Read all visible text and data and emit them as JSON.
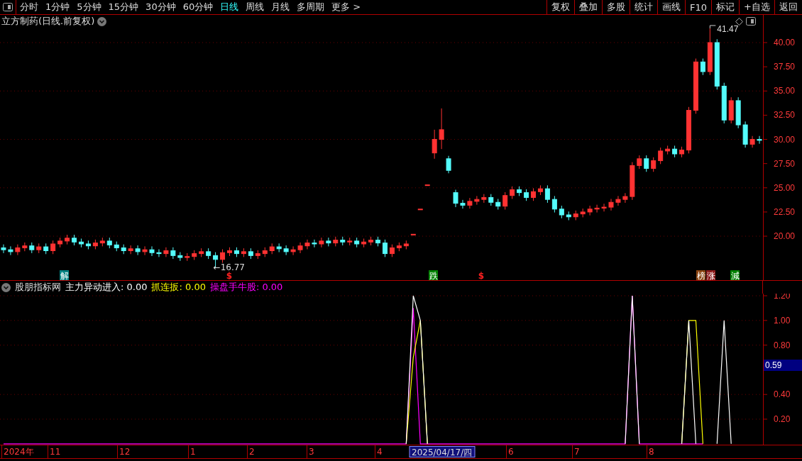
{
  "toolbar": {
    "periods": [
      {
        "label": "分时",
        "selected": false
      },
      {
        "label": "1分钟",
        "selected": false
      },
      {
        "label": "5分钟",
        "selected": false
      },
      {
        "label": "15分钟",
        "selected": false
      },
      {
        "label": "30分钟",
        "selected": false
      },
      {
        "label": "60分钟",
        "selected": false
      },
      {
        "label": "日线",
        "selected": true
      },
      {
        "label": "周线",
        "selected": false
      },
      {
        "label": "月线",
        "selected": false
      },
      {
        "label": "多周期",
        "selected": false
      },
      {
        "label": "更多 >",
        "selected": false
      }
    ],
    "actions": [
      "复权",
      "叠加",
      "多股",
      "统计",
      "画线",
      "F10",
      "标记",
      "+自选",
      "返回"
    ]
  },
  "price_panel": {
    "title": "立方制药(日线.前复权)",
    "chart_data": {
      "type": "candlestick",
      "grid": true,
      "ylim": [
        15.46,
        42.86
      ],
      "yticks": [
        {
          "value": 20,
          "label": "20.00"
        },
        {
          "value": 22.5,
          "label": "22.50"
        },
        {
          "value": 25,
          "label": "25.00"
        },
        {
          "value": 27.5,
          "label": "27.50"
        },
        {
          "value": 30,
          "label": "30.00"
        },
        {
          "value": 32.5,
          "label": "32.50"
        },
        {
          "value": 35,
          "label": "35.00"
        },
        {
          "value": 37.5,
          "label": "37.50"
        },
        {
          "value": 40,
          "label": "40.00"
        }
      ],
      "categories": [
        null,
        null,
        null,
        null,
        null,
        null,
        null,
        null,
        null,
        null,
        null,
        null,
        null,
        null,
        null,
        null,
        null,
        null,
        null,
        null,
        null,
        null,
        null,
        null,
        null,
        null,
        null,
        null,
        null,
        null,
        null,
        null,
        null,
        null,
        null,
        null,
        null,
        null,
        null,
        null,
        null,
        null,
        null,
        null,
        null,
        null,
        null,
        null,
        null,
        null,
        null,
        null,
        null,
        null,
        null,
        null,
        null,
        null,
        null,
        null,
        null,
        null,
        null,
        null,
        null,
        null,
        null,
        null,
        null,
        null,
        null,
        null,
        null,
        null,
        null,
        null,
        null,
        null,
        null,
        null,
        null,
        null,
        null,
        null,
        null,
        null,
        null,
        null,
        null,
        null,
        null,
        null,
        null,
        null,
        null,
        null,
        null,
        null,
        null,
        null,
        null,
        null,
        null,
        null,
        null,
        null,
        null,
        null
      ],
      "ohlc": [
        [
          18.8,
          19.15,
          18.25,
          18.6
        ],
        [
          18.6,
          18.95,
          18.05,
          18.4
        ],
        [
          18.4,
          19.15,
          18.05,
          18.8
        ],
        [
          18.8,
          19.35,
          18.45,
          19.0
        ],
        [
          19.0,
          19.35,
          18.25,
          18.6
        ],
        [
          18.6,
          19.25,
          18.25,
          18.9
        ],
        [
          18.9,
          19.25,
          18.15,
          18.5
        ],
        [
          18.5,
          19.55,
          18.15,
          19.2
        ],
        [
          19.2,
          19.85,
          18.85,
          19.5
        ],
        [
          19.5,
          20.15,
          19.15,
          19.8
        ],
        [
          19.8,
          20.15,
          19.05,
          19.4
        ],
        [
          19.4,
          19.75,
          18.85,
          19.2
        ],
        [
          19.2,
          19.55,
          18.65,
          19.0
        ],
        [
          19.0,
          19.65,
          18.65,
          19.3
        ],
        [
          19.3,
          19.85,
          18.95,
          19.5
        ],
        [
          19.5,
          19.85,
          18.75,
          19.1
        ],
        [
          19.1,
          19.45,
          18.45,
          18.8
        ],
        [
          18.8,
          19.15,
          18.15,
          18.5
        ],
        [
          18.5,
          19.05,
          18.15,
          18.7
        ],
        [
          18.7,
          19.05,
          18.05,
          18.4
        ],
        [
          18.4,
          18.95,
          18.05,
          18.6
        ],
        [
          18.6,
          18.95,
          17.95,
          18.3
        ],
        [
          18.3,
          18.65,
          17.85,
          18.2
        ],
        [
          18.2,
          18.85,
          17.85,
          18.5
        ],
        [
          18.5,
          18.85,
          17.65,
          18.0
        ],
        [
          18.0,
          18.35,
          17.45,
          17.8
        ],
        [
          17.8,
          18.25,
          17.45,
          17.9
        ],
        [
          17.9,
          18.55,
          17.55,
          18.2
        ],
        [
          18.2,
          18.75,
          17.85,
          18.4
        ],
        [
          18.4,
          18.75,
          17.65,
          18.0
        ],
        [
          18.0,
          18.35,
          16.77,
          17.6
        ],
        [
          17.6,
          18.65,
          17.25,
          18.3
        ],
        [
          18.3,
          18.85,
          17.95,
          18.5
        ],
        [
          18.5,
          18.85,
          17.85,
          18.2
        ],
        [
          18.2,
          18.75,
          17.85,
          18.4
        ],
        [
          18.4,
          18.75,
          17.65,
          18.0
        ],
        [
          18.0,
          18.55,
          17.65,
          18.2
        ],
        [
          18.2,
          18.85,
          17.85,
          18.5
        ],
        [
          18.5,
          19.25,
          18.15,
          18.9
        ],
        [
          18.9,
          19.25,
          18.35,
          18.7
        ],
        [
          18.7,
          19.05,
          18.05,
          18.4
        ],
        [
          18.4,
          18.95,
          18.05,
          18.6
        ],
        [
          18.6,
          19.35,
          18.25,
          19.0
        ],
        [
          19.0,
          19.65,
          18.65,
          19.3
        ],
        [
          19.3,
          19.65,
          18.85,
          19.2
        ],
        [
          19.2,
          19.85,
          18.85,
          19.5
        ],
        [
          19.5,
          19.85,
          18.95,
          19.3
        ],
        [
          19.3,
          19.95,
          18.95,
          19.6
        ],
        [
          19.6,
          19.95,
          19.05,
          19.4
        ],
        [
          19.4,
          19.85,
          19.05,
          19.5
        ],
        [
          19.5,
          19.85,
          18.85,
          19.2
        ],
        [
          19.2,
          19.75,
          18.85,
          19.4
        ],
        [
          19.4,
          19.95,
          19.05,
          19.6
        ],
        [
          19.6,
          19.95,
          18.95,
          19.3
        ],
        [
          19.3,
          19.65,
          17.85,
          18.2
        ],
        [
          18.2,
          19.15,
          17.85,
          18.8
        ],
        [
          18.8,
          19.35,
          18.45,
          19.0
        ],
        [
          19.0,
          19.55,
          18.65,
          19.2
        ],
        [
          20.2,
          20.2,
          20.2,
          20.2
        ],
        [
          22.8,
          22.8,
          22.8,
          22.8
        ],
        [
          25.3,
          25.3,
          25.3,
          25.3
        ],
        [
          28.6,
          31.0,
          28.0,
          30.0
        ],
        [
          30.0,
          33.2,
          29.0,
          31.0
        ],
        [
          28.0,
          28.3,
          26.5,
          26.8
        ],
        [
          24.5,
          24.8,
          23.0,
          23.4
        ],
        [
          23.4,
          23.75,
          22.85,
          23.2
        ],
        [
          23.2,
          23.95,
          22.85,
          23.6
        ],
        [
          23.6,
          24.15,
          23.25,
          23.8
        ],
        [
          23.8,
          24.35,
          23.45,
          24.0
        ],
        [
          24.0,
          24.35,
          23.15,
          23.5
        ],
        [
          23.5,
          23.85,
          22.75,
          23.1
        ],
        [
          23.1,
          24.55,
          22.75,
          24.2
        ],
        [
          24.2,
          25.15,
          23.85,
          24.8
        ],
        [
          24.8,
          25.15,
          24.15,
          24.5
        ],
        [
          24.5,
          24.85,
          23.65,
          24.0
        ],
        [
          24.0,
          24.95,
          23.65,
          24.6
        ],
        [
          24.6,
          25.25,
          24.25,
          24.9
        ],
        [
          24.9,
          25.25,
          23.45,
          23.8
        ],
        [
          23.8,
          24.15,
          22.45,
          22.8
        ],
        [
          22.8,
          23.15,
          21.85,
          22.2
        ],
        [
          22.2,
          22.55,
          21.65,
          22.0
        ],
        [
          22.0,
          22.65,
          21.65,
          22.3
        ],
        [
          22.3,
          22.85,
          21.95,
          22.5
        ],
        [
          22.5,
          23.15,
          22.15,
          22.8
        ],
        [
          22.8,
          23.25,
          22.45,
          22.9
        ],
        [
          22.9,
          23.35,
          22.55,
          23.0
        ],
        [
          23.0,
          23.85,
          22.65,
          23.5
        ],
        [
          23.5,
          24.15,
          23.15,
          23.8
        ],
        [
          23.8,
          24.45,
          23.45,
          24.1
        ],
        [
          24.1,
          27.65,
          23.75,
          27.3
        ],
        [
          27.3,
          28.35,
          26.95,
          28.0
        ],
        [
          28.0,
          28.35,
          26.65,
          27.0
        ],
        [
          27.0,
          28.15,
          26.65,
          27.8
        ],
        [
          27.8,
          29.15,
          27.45,
          28.8
        ],
        [
          28.8,
          29.35,
          28.45,
          29.0
        ],
        [
          29.0,
          29.35,
          28.15,
          28.5
        ],
        [
          28.5,
          29.25,
          28.15,
          28.9
        ],
        [
          28.9,
          33.35,
          28.55,
          33.0
        ],
        [
          33.0,
          38.35,
          32.65,
          38.0
        ],
        [
          38.0,
          38.35,
          36.65,
          37.0
        ],
        [
          37.0,
          41.47,
          36.65,
          40.0
        ],
        [
          40.0,
          40.35,
          35.15,
          35.5
        ],
        [
          35.5,
          35.85,
          31.65,
          32.0
        ],
        [
          32.0,
          34.35,
          31.65,
          34.0
        ],
        [
          34.0,
          34.35,
          31.15,
          31.5
        ],
        [
          31.5,
          31.85,
          29.15,
          29.5
        ],
        [
          29.5,
          30.35,
          29.15,
          30.0
        ],
        [
          30.0,
          30.35,
          29.55,
          29.9
        ]
      ],
      "annotations": [
        "41.47",
        "←16.77"
      ]
    },
    "signals": [
      {
        "kind": "tag",
        "label": "解",
        "color": "#008080"
      },
      {
        "kind": "mark",
        "label": "$",
        "color": "#ff2020"
      },
      {
        "kind": "tag",
        "label": "跌",
        "color": "#008000"
      },
      {
        "kind": "mark",
        "label": "$",
        "color": "#ff2020"
      },
      {
        "kind": "tag",
        "label": "榜",
        "color": "#8b4513"
      },
      {
        "kind": "tag",
        "label": "涨",
        "color": "#8b1a1a"
      },
      {
        "kind": "tag",
        "label": "減",
        "color": "#008000"
      }
    ]
  },
  "indicator_panel": {
    "name": "股朋指标网",
    "readouts": [
      {
        "label": "主力异动进入: 0.00",
        "color": "#ffffff"
      },
      {
        "label": "抓连扳: 0.00",
        "color": "#ffff00"
      },
      {
        "label": "操盘手牛股: 0.00",
        "color": "#ff00ff"
      }
    ],
    "axis_readout": "0.59",
    "chart_data": {
      "type": "line",
      "grid": true,
      "ylim": [
        0,
        1.2
      ],
      "categories": [
        null,
        null,
        null,
        null,
        null,
        null,
        null,
        null,
        null,
        null,
        null,
        null,
        null,
        null,
        null,
        null,
        null,
        null,
        null,
        null,
        null,
        null,
        null,
        null,
        null,
        null,
        null,
        null,
        null,
        null,
        null,
        null,
        null,
        null,
        null,
        null,
        null,
        null,
        null,
        null,
        null,
        null,
        null,
        null,
        null,
        null,
        null,
        null,
        null,
        null,
        null,
        null,
        null,
        null,
        null,
        null,
        null,
        null,
        null,
        null,
        null,
        null,
        null,
        null,
        null,
        null,
        null,
        null,
        null,
        null,
        null,
        null,
        null,
        null,
        null,
        null,
        null,
        null,
        null,
        null,
        null,
        null,
        null,
        null,
        null,
        null,
        null,
        null,
        null,
        null,
        null,
        null,
        null,
        null,
        null,
        null,
        null,
        null,
        null,
        null,
        null,
        null,
        null,
        null,
        null,
        null,
        null,
        null
      ],
      "yticks": [
        {
          "value": 0.2,
          "label": "0.20"
        },
        {
          "value": 0.4,
          "label": "0.40"
        },
        {
          "value": 0.8,
          "label": "0.80"
        },
        {
          "value": 1.0,
          "label": "1.00"
        },
        {
          "value": 1.2,
          "label": "1.20"
        }
      ],
      "series": [
        {
          "color": "#ffffff",
          "values": [
            null,
            null,
            null,
            null,
            null,
            null,
            null,
            null,
            null,
            null,
            null,
            null,
            null,
            null,
            null,
            null,
            null,
            null,
            null,
            null,
            null,
            null,
            null,
            null,
            null,
            null,
            null,
            null,
            null,
            null,
            null,
            null,
            null,
            null,
            null,
            null,
            null,
            null,
            null,
            null,
            null,
            null,
            null,
            null,
            null,
            null,
            null,
            null,
            null,
            null,
            null,
            null,
            null,
            null,
            null,
            null,
            null,
            0,
            1.2,
            1.0,
            0,
            null,
            null,
            null,
            null,
            null,
            null,
            null,
            null,
            null,
            null,
            null,
            null,
            null,
            null,
            null,
            null,
            null,
            null,
            null,
            null,
            null,
            null,
            null,
            null,
            null,
            null,
            null,
            0,
            1.2,
            0,
            null,
            null,
            null,
            null,
            null,
            0,
            1.0,
            0,
            null,
            null,
            0,
            1.0,
            0,
            null,
            null,
            null,
            null
          ]
        },
        {
          "color": "#ffff00",
          "values": [
            null,
            null,
            null,
            null,
            null,
            null,
            null,
            null,
            null,
            null,
            null,
            null,
            null,
            null,
            null,
            null,
            null,
            null,
            null,
            null,
            null,
            null,
            null,
            null,
            null,
            null,
            null,
            null,
            null,
            null,
            null,
            null,
            null,
            null,
            null,
            null,
            null,
            null,
            null,
            null,
            null,
            null,
            null,
            null,
            null,
            null,
            null,
            null,
            null,
            null,
            null,
            null,
            null,
            null,
            null,
            null,
            null,
            0,
            0.7,
            1.0,
            0,
            null,
            null,
            null,
            null,
            null,
            null,
            null,
            null,
            null,
            null,
            null,
            null,
            null,
            null,
            null,
            null,
            null,
            null,
            null,
            null,
            null,
            null,
            null,
            null,
            null,
            null,
            null,
            null,
            null,
            null,
            null,
            null,
            null,
            null,
            null,
            0,
            1.0,
            1.0,
            0,
            null,
            null,
            null,
            null,
            null,
            null,
            null,
            null
          ]
        },
        {
          "color": "#ff00ff",
          "values": [
            0,
            0,
            0,
            0,
            0,
            0,
            0,
            0,
            0,
            0,
            0,
            0,
            0,
            0,
            0,
            0,
            0,
            0,
            0,
            0,
            0,
            0,
            0,
            0,
            0,
            0,
            0,
            0,
            0,
            0,
            0,
            0,
            0,
            0,
            0,
            0,
            0,
            0,
            0,
            0,
            0,
            0,
            0,
            0,
            0,
            0,
            0,
            0,
            0,
            0,
            0,
            0,
            0,
            0,
            0,
            0,
            0,
            0,
            1.1,
            0,
            0,
            0,
            0,
            0,
            0,
            0,
            0,
            0,
            0,
            0,
            0,
            0,
            0,
            0,
            0,
            0,
            0,
            0,
            0,
            0,
            0,
            0,
            0,
            0,
            0,
            0,
            0,
            0,
            0,
            1.2,
            0,
            0,
            0,
            0,
            0,
            0,
            0,
            0,
            0,
            0,
            null,
            null,
            null,
            null,
            null,
            null,
            null,
            null
          ]
        }
      ]
    }
  },
  "time_axis": {
    "labels": [
      "2024年",
      "11",
      "12",
      "1",
      "2",
      "3",
      "4",
      "6",
      "7",
      "8"
    ],
    "cursor_label": "2025/04/17/四"
  }
}
